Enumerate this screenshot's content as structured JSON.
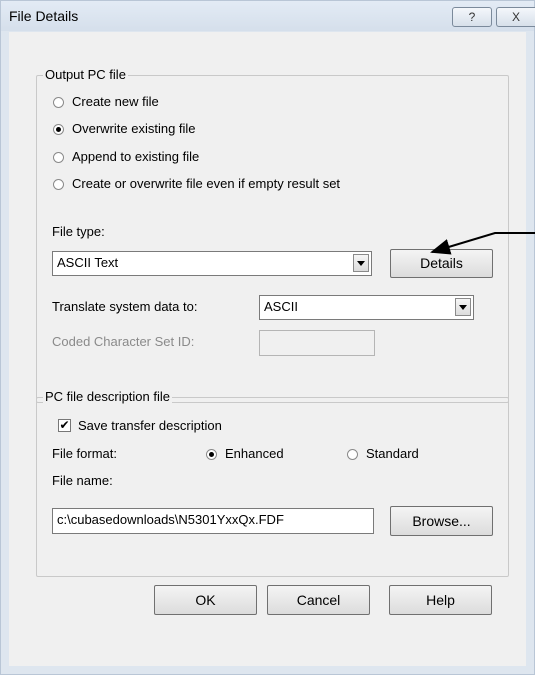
{
  "window": {
    "title": "File Details",
    "help_glyph": "?",
    "close_glyph": "X"
  },
  "output_group": {
    "legend": "Output PC file",
    "options": [
      {
        "label": "Create new file",
        "checked": false
      },
      {
        "label": "Overwrite existing file",
        "checked": true
      },
      {
        "label": "Append to existing file",
        "checked": false
      },
      {
        "label": "Create or overwrite file even if empty result set",
        "checked": false
      }
    ],
    "file_type_label": "File type:",
    "file_type_value": "ASCII Text",
    "details_button": "Details",
    "translate_label": "Translate system data to:",
    "translate_value": "ASCII",
    "ccsid_label": "Coded Character Set ID:",
    "ccsid_value": ""
  },
  "description_group": {
    "legend": "PC file description file",
    "save_label": "Save transfer description",
    "save_checked": true,
    "format_label": "File format:",
    "format_options": [
      {
        "label": "Enhanced",
        "checked": true
      },
      {
        "label": "Standard",
        "checked": false
      }
    ],
    "file_name_label": "File name:",
    "file_name_value": "c:\\cubasedownloads\\N5301YxxQx.FDF",
    "browse_button": "Browse..."
  },
  "buttons": {
    "ok": "OK",
    "cancel": "Cancel",
    "help": "Help"
  }
}
